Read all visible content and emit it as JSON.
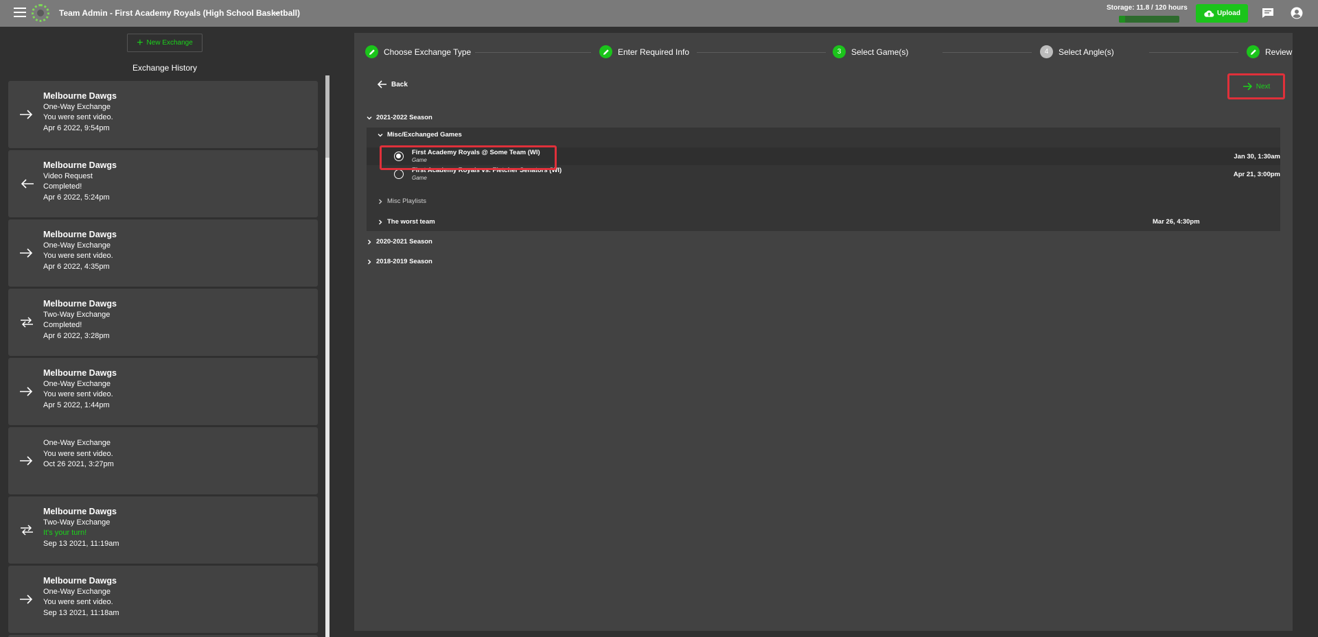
{
  "header": {
    "title": "Team Admin - First Academy Royals (High School Basketball)",
    "storage_label": "Storage: 11.8 / 120 hours",
    "storage_used_fraction": 0.098,
    "upload_label": "Upload",
    "accent_color": "#1bc41b"
  },
  "sidebar": {
    "new_exchange_label": "New Exchange",
    "history_title": "Exchange History",
    "cards": [
      {
        "team": "Melbourne Dawgs",
        "lines": [
          "One-Way Exchange",
          "You were sent video.",
          "Apr 6 2022, 9:54pm"
        ],
        "icon": "arrow-right-icon"
      },
      {
        "team": "Melbourne Dawgs",
        "lines": [
          "Video Request",
          "Completed!",
          "Apr 6 2022, 5:24pm"
        ],
        "icon": "arrow-left-icon"
      },
      {
        "team": "Melbourne Dawgs",
        "lines": [
          "One-Way Exchange",
          "You were sent video.",
          "Apr 6 2022, 4:35pm"
        ],
        "icon": "arrow-right-icon"
      },
      {
        "team": "Melbourne Dawgs",
        "lines": [
          "Two-Way Exchange",
          "Completed!",
          "Apr 6 2022, 3:28pm"
        ],
        "icon": "swap-icon"
      },
      {
        "team": "Melbourne Dawgs",
        "lines": [
          "One-Way Exchange",
          "You were sent video.",
          "Apr 5 2022, 1:44pm"
        ],
        "icon": "arrow-right-icon"
      },
      {
        "team": "",
        "lines": [
          "One-Way Exchange",
          "You were sent video.",
          "Oct 26 2021, 3:27pm"
        ],
        "icon": "arrow-right-icon"
      },
      {
        "team": "Melbourne Dawgs",
        "lines": [
          "Two-Way Exchange",
          "It's your turn!",
          "Sep 13 2021, 11:19am"
        ],
        "icon": "swap-icon"
      },
      {
        "team": "Melbourne Dawgs",
        "lines": [
          "One-Way Exchange",
          "You were sent video.",
          "Sep 13 2021, 11:18am"
        ],
        "icon": "arrow-right-icon"
      }
    ]
  },
  "stepper": {
    "steps": [
      {
        "label": "Choose Exchange Type",
        "state": "done"
      },
      {
        "label": "Enter Required Info",
        "state": "done"
      },
      {
        "label": "Select Game(s)",
        "state": "current",
        "number": "3"
      },
      {
        "label": "Select Angle(s)",
        "state": "pending",
        "number": "4"
      },
      {
        "label": "Review",
        "state": "done"
      }
    ]
  },
  "nav": {
    "back_label": "Back",
    "next_label": "Next"
  },
  "tree": {
    "season_2122": "2021-2022 Season",
    "group_misc": "Misc/Exchanged Games",
    "games": [
      {
        "name": "First Academy Royals @ Some Team (WI)",
        "type": "Game",
        "date": "Jan 30, 1:30am",
        "selected": true
      },
      {
        "name": "First Academy Royals vs. Fletcher Senators (WI)",
        "type": "Game",
        "date": "Apr 21, 3:00pm",
        "selected": false
      }
    ],
    "misc_playlists": "Misc Playlists",
    "worst_team": "The worst team",
    "worst_team_date": "Mar 26, 4:30pm",
    "season_2021": "2020-2021 Season",
    "season_1819": "2018-2019 Season"
  }
}
